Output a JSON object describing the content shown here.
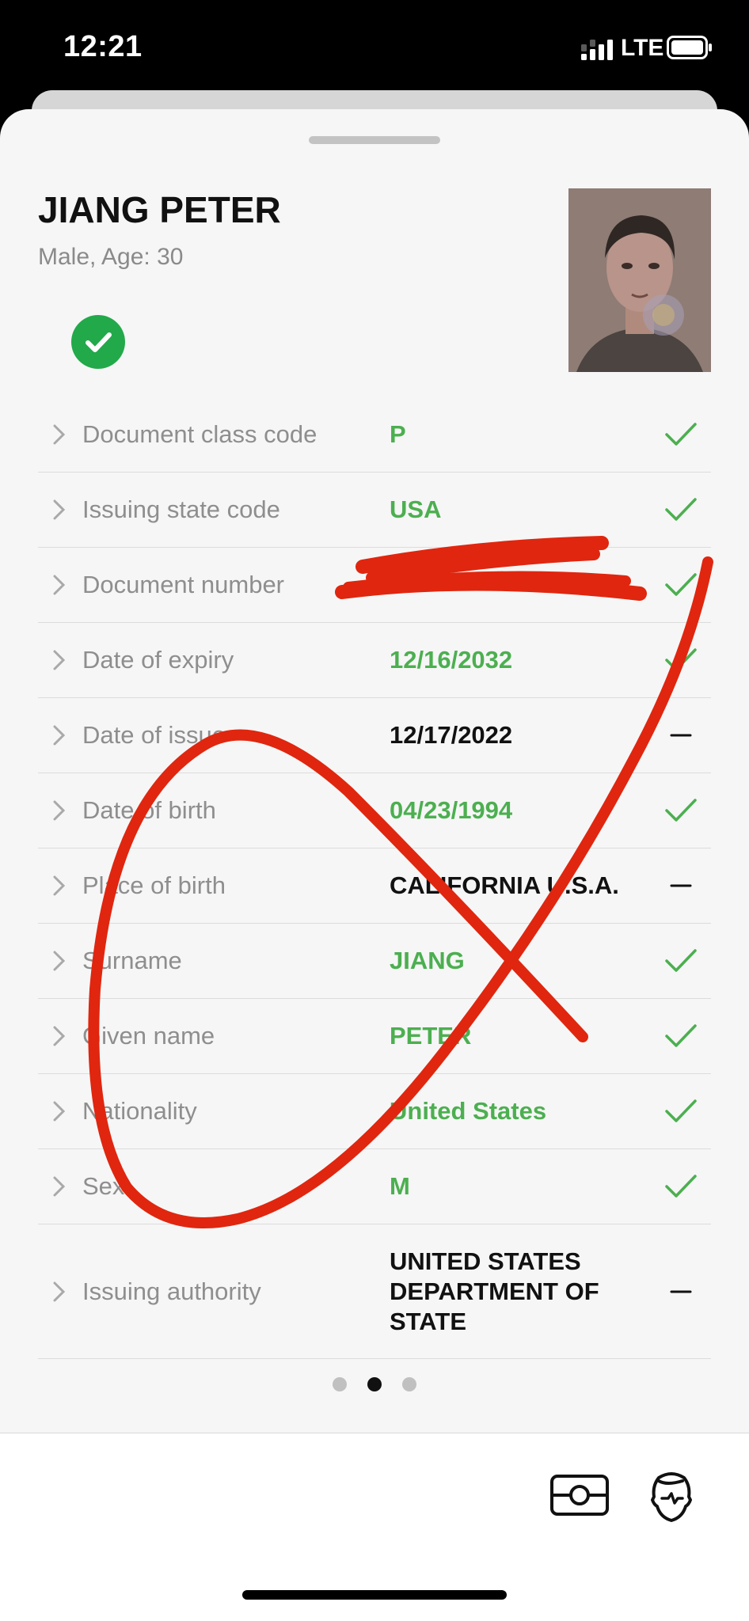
{
  "status_bar": {
    "time": "12:21",
    "network": "LTE",
    "signal_icon": "signal-bars-icon",
    "battery_icon": "battery-icon"
  },
  "profile": {
    "name": "JIANG PETER",
    "subtitle": "Male, Age: 30",
    "verified_icon": "check-circle-icon",
    "verified_color": "#22a94a"
  },
  "fields": [
    {
      "label": "Document class code",
      "value": "P",
      "status": "check"
    },
    {
      "label": "Issuing state code",
      "value": "USA",
      "status": "check"
    },
    {
      "label": "Document number",
      "value": "",
      "status": "check"
    },
    {
      "label": "Date of expiry",
      "value": "12/16/2032",
      "status": "check"
    },
    {
      "label": "Date of issue",
      "value": "12/17/2022",
      "status": "dash"
    },
    {
      "label": "Date of birth",
      "value": "04/23/1994",
      "status": "check"
    },
    {
      "label": "Place of birth",
      "value": "CALIFORNIA U.S.A.",
      "status": "dash"
    },
    {
      "label": "Surname",
      "value": "JIANG",
      "status": "check"
    },
    {
      "label": "Given name",
      "value": "PETER",
      "status": "check"
    },
    {
      "label": "Nationality",
      "value": "United States",
      "status": "check"
    },
    {
      "label": "Sex",
      "value": "M",
      "status": "check"
    },
    {
      "label": "Issuing authority",
      "value": "UNITED STATES DEPARTMENT OF STATE",
      "status": "dash"
    }
  ],
  "colors": {
    "verified_value": "#4caf50",
    "check_mark": "#4caf50",
    "annotation_red": "#e0260f"
  },
  "pagination": {
    "total": 3,
    "active": 2
  },
  "bottom_bar": {
    "left_icon": "id-card-icon",
    "right_icon": "face-scan-icon"
  }
}
